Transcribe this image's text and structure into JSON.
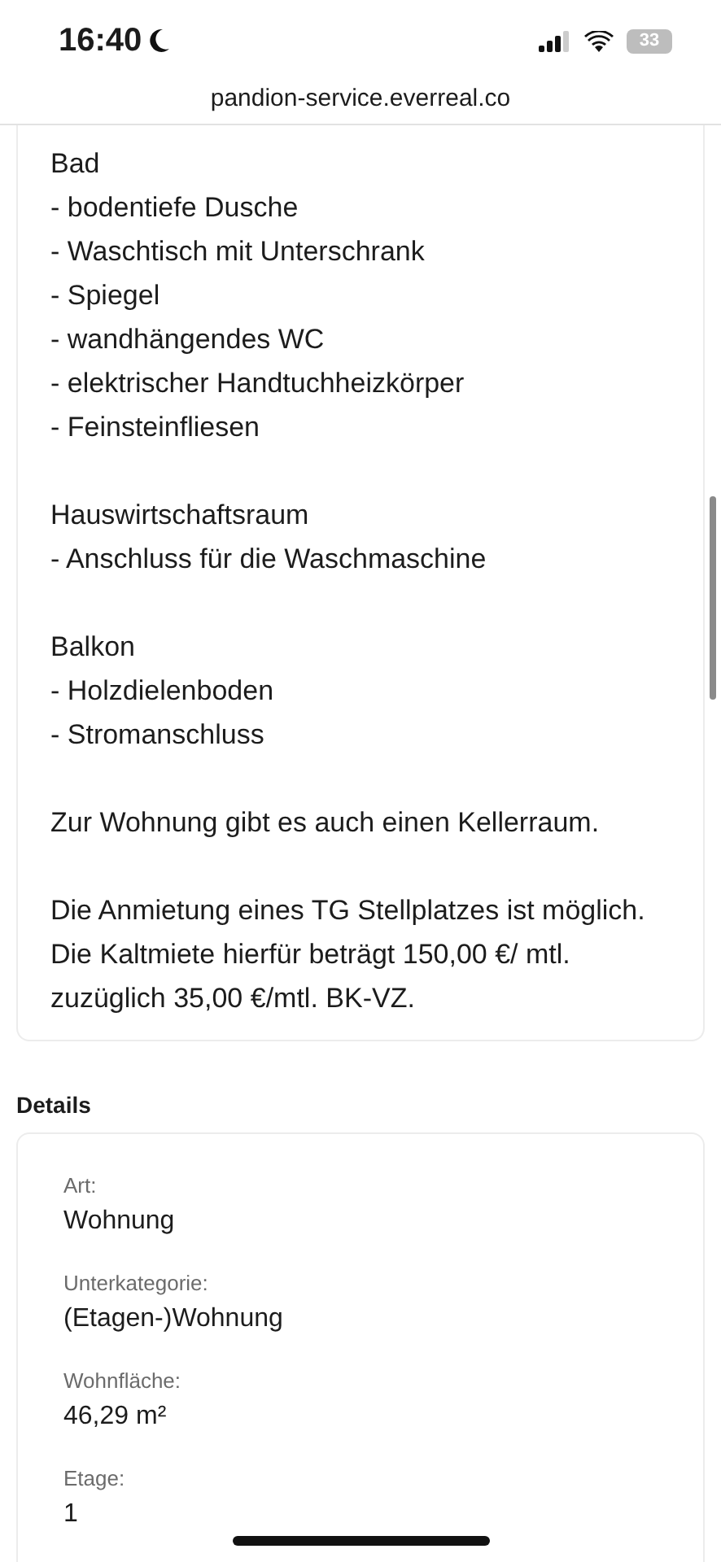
{
  "status_bar": {
    "time": "16:40",
    "battery": "33"
  },
  "address_bar": {
    "url": "pandion-service.everreal.co"
  },
  "description": [
    [
      "Bad",
      "- bodentiefe Dusche",
      "- Waschtisch mit Unterschrank",
      "- Spiegel",
      "- wandhängendes WC",
      "- elektrischer Handtuchheizkörper",
      "- Feinsteinfliesen"
    ],
    [
      "Hauswirtschaftsraum",
      "- Anschluss für die Waschmaschine"
    ],
    [
      "Balkon",
      "- Holzdielenboden",
      "- Stromanschluss"
    ],
    [
      "Zur Wohnung gibt es auch einen Kellerraum."
    ],
    [
      "Die Anmietung eines TG Stellplatzes ist möglich. Die Kaltmiete hierfür beträgt 150,00 €/ mtl. zuzüglich 35,00 €/mtl. BK-VZ."
    ]
  ],
  "details": {
    "title": "Details",
    "items": [
      {
        "label": "Art:",
        "value": "Wohnung"
      },
      {
        "label": "Unterkategorie:",
        "value": "(Etagen-)Wohnung"
      },
      {
        "label": "Wohnfläche:",
        "value": "46,29 m²"
      },
      {
        "label": "Etage:",
        "value": "1"
      }
    ]
  }
}
